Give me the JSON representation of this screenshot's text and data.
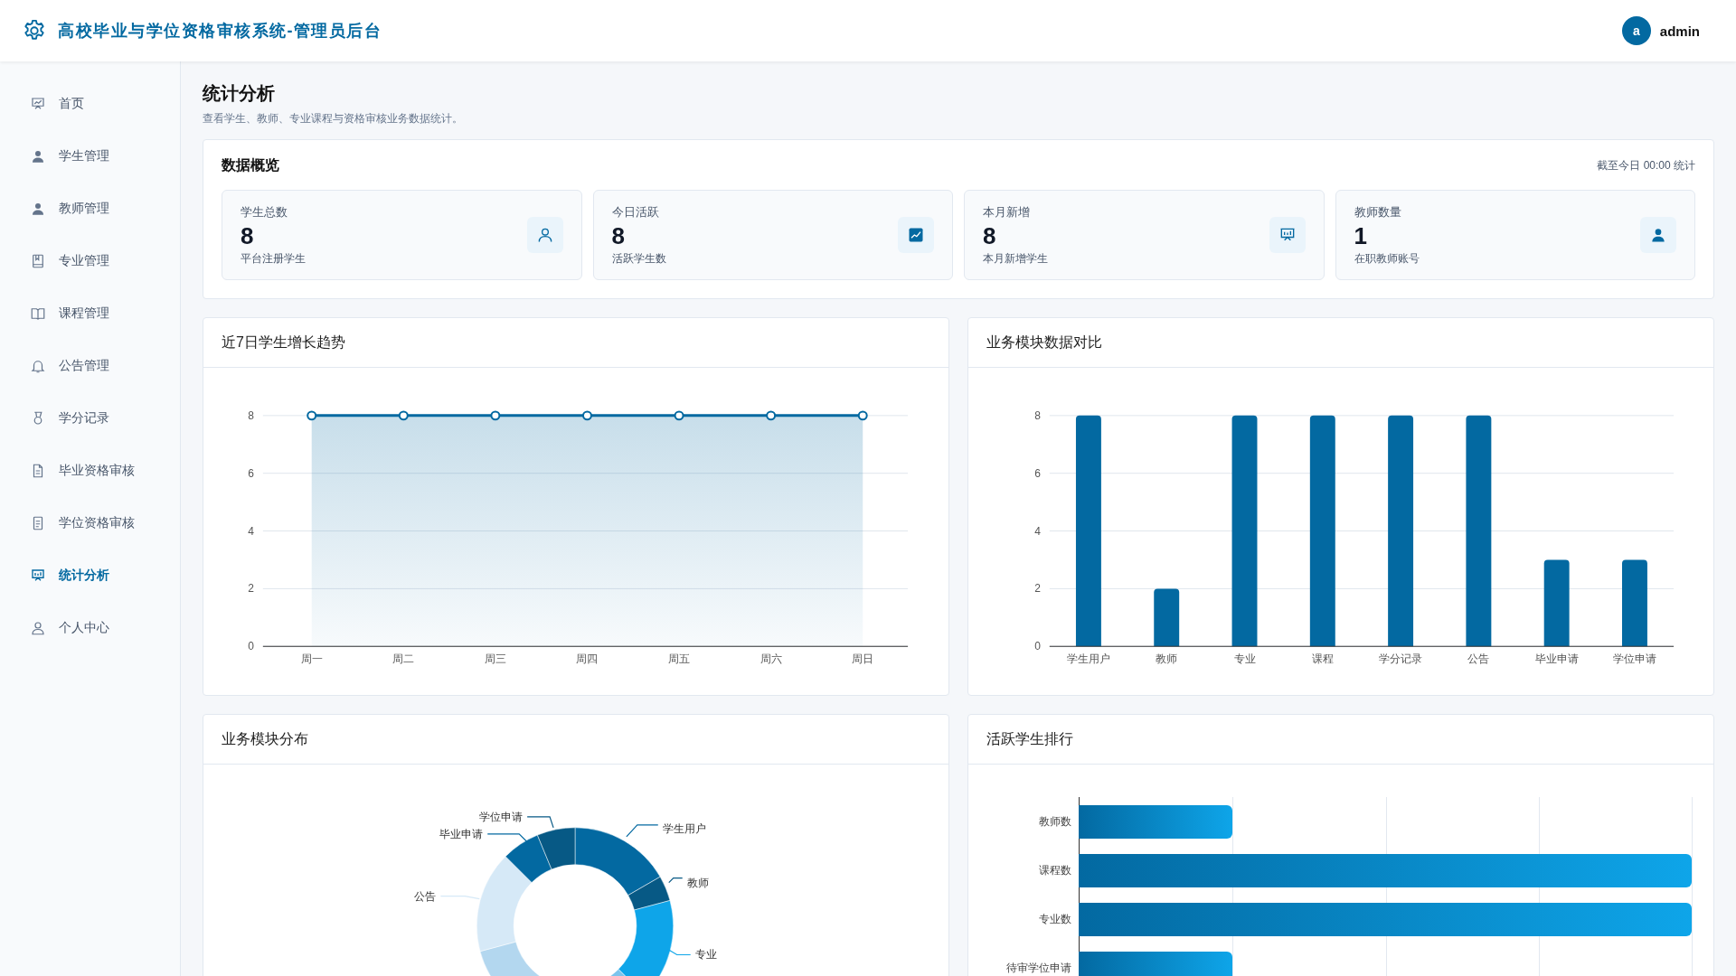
{
  "header": {
    "title": "高校毕业与学位资格审核系统-管理员后台",
    "avatar": "a",
    "username": "admin"
  },
  "sidebar": {
    "items": [
      {
        "label": "首页",
        "selected": false
      },
      {
        "label": "学生管理",
        "selected": false
      },
      {
        "label": "教师管理",
        "selected": false
      },
      {
        "label": "专业管理",
        "selected": false
      },
      {
        "label": "课程管理",
        "selected": false
      },
      {
        "label": "公告管理",
        "selected": false
      },
      {
        "label": "学分记录",
        "selected": false
      },
      {
        "label": "毕业资格审核",
        "selected": false
      },
      {
        "label": "学位资格审核",
        "selected": false
      },
      {
        "label": "统计分析",
        "selected": true
      },
      {
        "label": "个人中心",
        "selected": false
      }
    ]
  },
  "page": {
    "title": "统计分析",
    "subtitle": "查看学生、教师、专业课程与资格审核业务数据统计。"
  },
  "overview": {
    "title": "数据概览",
    "note": "截至今日 00:00 统计",
    "cards": [
      {
        "label": "学生总数",
        "value": "8",
        "caption": "平台注册学生"
      },
      {
        "label": "今日活跃",
        "value": "8",
        "caption": "活跃学生数"
      },
      {
        "label": "本月新增",
        "value": "8",
        "caption": "本月新增学生"
      },
      {
        "label": "教师数量",
        "value": "1",
        "caption": "在职教师账号"
      }
    ]
  },
  "growth": {
    "title": "近7日学生增长趋势",
    "chart_data": {
      "type": "area",
      "x": [
        "周一",
        "周二",
        "周三",
        "周四",
        "周五",
        "周六",
        "周日"
      ],
      "series": [
        {
          "color": "#0369a1",
          "values": [
            8,
            8,
            8,
            8,
            8,
            8,
            8
          ]
        }
      ],
      "ylim": [
        0,
        8
      ],
      "yticks": [
        0,
        2,
        4,
        6,
        8
      ],
      "grid": true
    }
  },
  "modules": {
    "title": "业务模块数据对比",
    "chart_data": {
      "type": "bar",
      "categories": [
        "学生用户",
        "教师",
        "专业",
        "课程",
        "学分记录",
        "公告",
        "毕业申请",
        "学位申请"
      ],
      "series": [
        {
          "color": "#0369a1",
          "values": [
            8,
            2,
            8,
            8,
            8,
            8,
            3,
            3
          ]
        }
      ],
      "ylim": [
        0,
        8
      ],
      "yticks": [
        0,
        2,
        4,
        6,
        8
      ],
      "grid": true
    }
  },
  "distribution": {
    "title": "业务模块分布",
    "labels": [
      "学生用户",
      "教师",
      "专业",
      "公告",
      "毕业申请",
      "学位申请"
    ]
  },
  "ranking": {
    "title": "活跃学生排行",
    "bars": [
      {
        "label": "教师数",
        "level": 0.25
      },
      {
        "label": "课程数",
        "level": 1
      },
      {
        "label": "专业数",
        "level": 1
      },
      {
        "label": "待审学位申请",
        "level": 0.25
      }
    ]
  }
}
